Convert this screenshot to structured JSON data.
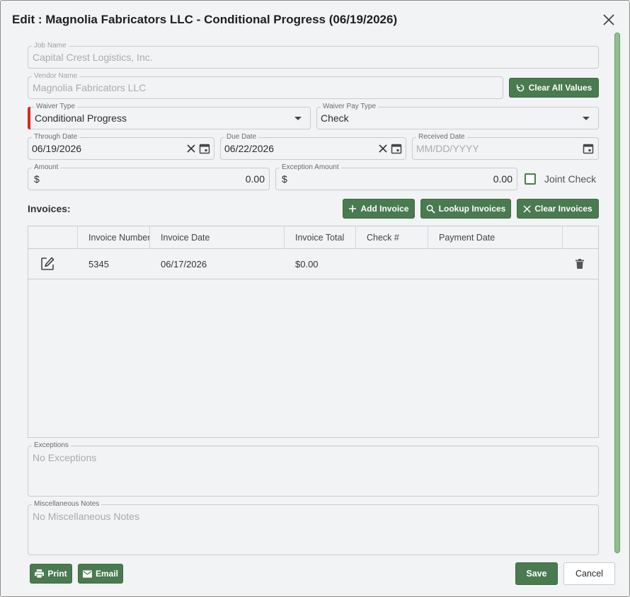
{
  "dialog": {
    "title": "Edit : Magnolia Fabricators LLC - Conditional Progress (06/19/2026)"
  },
  "fields": {
    "job_name": {
      "label": "Job Name",
      "value": "Capital Crest Logistics, Inc."
    },
    "vendor_name": {
      "label": "Vendor Name",
      "value": "Magnolia Fabricators LLC"
    },
    "waiver_type": {
      "label": "Waiver Type",
      "value": "Conditional Progress"
    },
    "waiver_pay_type": {
      "label": "Waiver Pay Type",
      "value": "Check"
    },
    "through_date": {
      "label": "Through Date",
      "value": "06/19/2026"
    },
    "due_date": {
      "label": "Due Date",
      "value": "06/22/2026"
    },
    "received_date": {
      "label": "Received Date",
      "placeholder": "MM/DD/YYYY"
    },
    "amount": {
      "label": "Amount",
      "currency": "$",
      "value": "0.00"
    },
    "exception_amount": {
      "label": "Exception Amount",
      "currency": "$",
      "value": "0.00"
    },
    "joint_check": {
      "label": "Joint Check",
      "checked": false
    }
  },
  "buttons": {
    "clear_all_values": "Clear All Values",
    "add_invoice": "Add Invoice",
    "lookup_invoices": "Lookup Invoices",
    "clear_invoices": "Clear Invoices",
    "print": "Print",
    "email": "Email",
    "save": "Save",
    "cancel": "Cancel"
  },
  "invoices": {
    "section_label": "Invoices:",
    "columns": [
      "Invoice Number",
      "Invoice Date",
      "Invoice Total",
      "Check #",
      "Payment Date"
    ],
    "rows": [
      {
        "invoice_number": "5345",
        "invoice_date": "06/17/2026",
        "invoice_total": "$0.00",
        "check_no": "",
        "payment_date": ""
      }
    ]
  },
  "exceptions": {
    "label": "Exceptions",
    "value": "No Exceptions"
  },
  "misc_notes": {
    "label": "Miscellaneous Notes",
    "value": "No Miscellaneous Notes"
  },
  "colors": {
    "accent_green": "#4a7a4f",
    "required_red": "#d9281e",
    "scroll_thumb": "#8fbf8f"
  },
  "icons": [
    "close-icon",
    "refresh-icon",
    "dropdown-arrow-icon",
    "clear-x-icon",
    "calendar-icon",
    "plus-icon",
    "search-icon",
    "edit-icon",
    "trash-icon",
    "printer-icon",
    "mail-icon"
  ]
}
